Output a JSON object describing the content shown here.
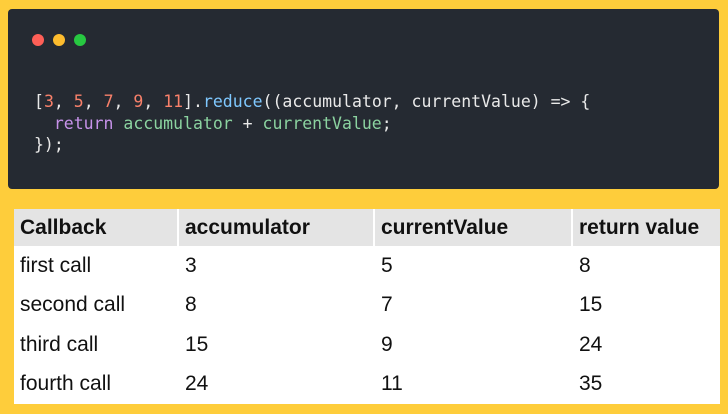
{
  "code_window": {
    "dots": [
      "close",
      "minimize",
      "maximize"
    ],
    "colors": {
      "close": "#fe5f57",
      "minimize": "#fdbc2e",
      "maximize": "#27c841"
    },
    "line1": {
      "open_bracket": "[",
      "n1": "3",
      "sep1": ", ",
      "n2": "5",
      "sep2": ", ",
      "n3": "7",
      "sep3": ", ",
      "n4": "9",
      "sep4": ", ",
      "n5": "11",
      "close_bracket": "].",
      "method": "reduce",
      "params": "((accumulator, currentValue) => {"
    },
    "line2": {
      "keyword": "return",
      "left": "accumulator",
      "op": " + ",
      "right": "currentValue",
      "end": ";"
    },
    "line3": "});"
  },
  "table": {
    "headers": [
      "Callback",
      "accumulator",
      "currentValue",
      "return value"
    ],
    "rows": [
      [
        "first call",
        "3",
        "5",
        "8"
      ],
      [
        "second call",
        "8",
        "7",
        "15"
      ],
      [
        "third call",
        "15",
        "9",
        "24"
      ],
      [
        "fourth call",
        "24",
        "11",
        "35"
      ]
    ]
  }
}
